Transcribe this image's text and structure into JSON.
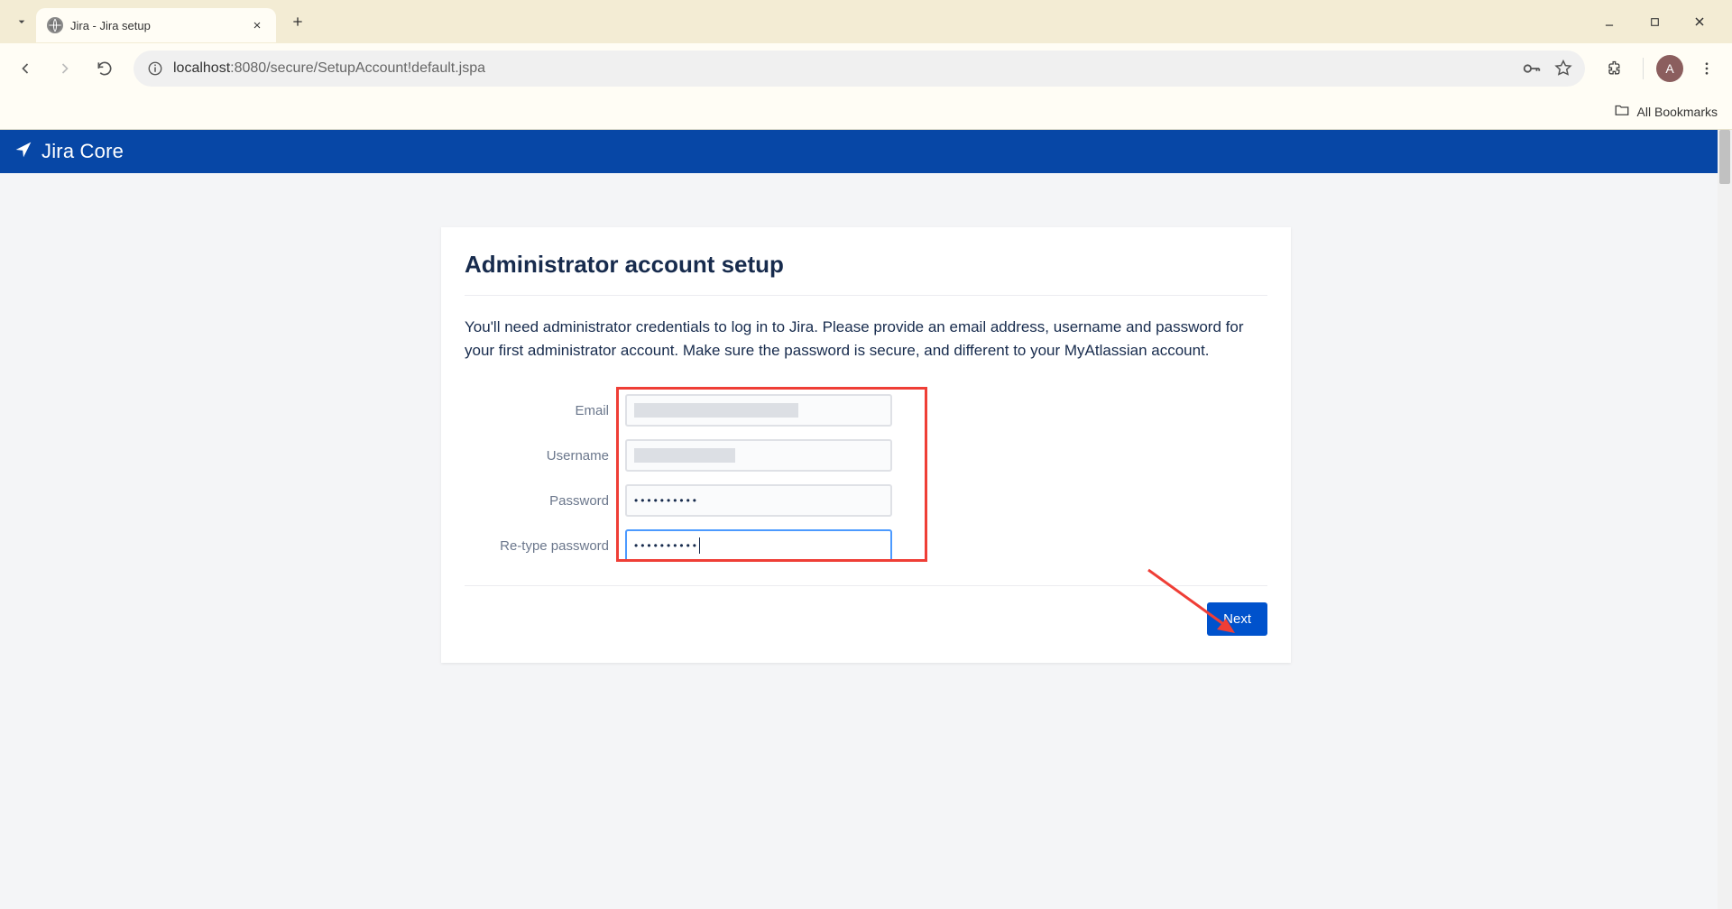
{
  "browser": {
    "tab_title": "Jira - Jira setup",
    "url_host": "localhost",
    "url_path": ":8080/secure/SetupAccount!default.jspa",
    "profile_letter": "A",
    "bookmarks_label": "All Bookmarks"
  },
  "header": {
    "logo_text": "Jira Core"
  },
  "page": {
    "title": "Administrator account setup",
    "description": "You'll need administrator credentials to log in to Jira. Please provide an email address, username and password for your first administrator account. Make sure the password is secure, and different to your MyAtlassian account.",
    "fields": {
      "email_label": "Email",
      "username_label": "Username",
      "password_label": "Password",
      "password_value": "••••••••••",
      "retype_label": "Re-type password",
      "retype_value": "••••••••••"
    },
    "next_label": "Next"
  }
}
